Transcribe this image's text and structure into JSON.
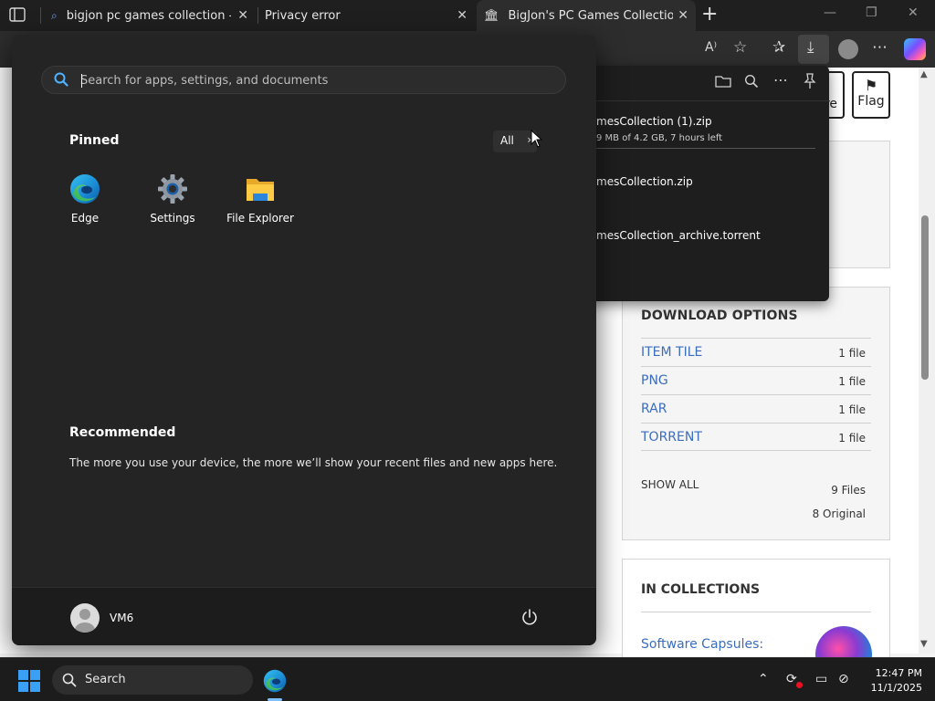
{
  "browser": {
    "tabs": [
      {
        "title": "bigjon pc games collection - Sear",
        "icon": "search-icon",
        "active": false
      },
      {
        "title": "Privacy error",
        "icon": "none",
        "active": false
      },
      {
        "title": "BigJon's PC Games Collection : Bi",
        "icon": "archive-icon",
        "active": true
      }
    ],
    "new_tab": "+",
    "window_controls": {
      "minimize": "—",
      "restore": "❐",
      "close": "✕"
    },
    "toolbar_icons": [
      "read-aloud-icon",
      "favorite-star-icon",
      "favorites-icon",
      "download-icon",
      "profile-icon",
      "more-icon",
      "copilot-icon"
    ]
  },
  "downloads_panel": {
    "items": [
      {
        "name": "mesCollection (1).zip",
        "status": "9 MB of 4.2 GB, 7 hours left"
      },
      {
        "name": "mesCollection.zip",
        "status": ""
      },
      {
        "name": "mesCollection_archive.torrent",
        "status": ""
      }
    ],
    "header_icons": [
      "folder-icon",
      "search-icon",
      "more-icon",
      "pin-icon"
    ]
  },
  "page": {
    "flag_label": "Flag",
    "share_partial": "re",
    "download_options": {
      "title": "DOWNLOAD OPTIONS",
      "rows": [
        {
          "format": "ITEM TILE",
          "count": "1 file"
        },
        {
          "format": "PNG",
          "count": "1 file"
        },
        {
          "format": "RAR",
          "count": "1 file"
        },
        {
          "format": "TORRENT",
          "count": "1 file"
        }
      ],
      "show_all": "SHOW ALL",
      "files_total": "9 Files",
      "files_original": "8 Original"
    },
    "in_collections": {
      "title": "IN COLLECTIONS",
      "link": "Software Capsules:"
    }
  },
  "start_menu": {
    "search_placeholder": "Search for apps, settings, and documents",
    "pinned_label": "Pinned",
    "all_label": "All",
    "all_chevron": "›",
    "apps": [
      {
        "label": "Edge",
        "icon": "edge-icon"
      },
      {
        "label": "Settings",
        "icon": "settings-gear-icon"
      },
      {
        "label": "File Explorer",
        "icon": "folder-icon"
      }
    ],
    "recommended_label": "Recommended",
    "recommended_text": "The more you use your device, the more we’ll show your recent files and new apps here.",
    "user_name": "VM6"
  },
  "taskbar": {
    "search_label": "Search",
    "time": "12:47 PM",
    "date": "11/1/2025",
    "tray_icons": [
      "chevron-up-icon",
      "sync-icon",
      "display-icon",
      "network-off-icon"
    ]
  },
  "colors": {
    "start_bg": "#242424",
    "taskbar_bg": "#1c1c1c",
    "link_blue": "#3b6dbf",
    "accent_blue": "#0078d4"
  }
}
